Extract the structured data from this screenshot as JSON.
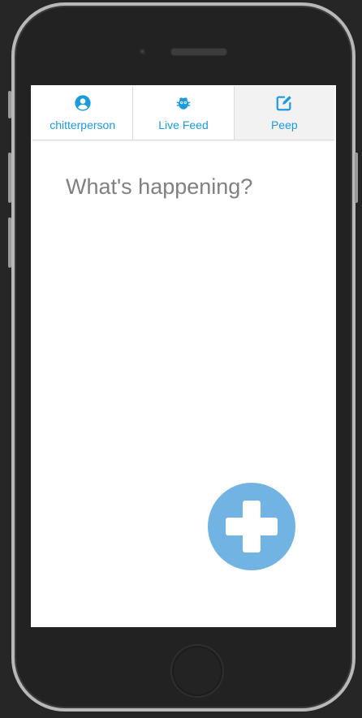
{
  "nav": {
    "items": [
      {
        "label": "chitterperson",
        "icon": "user-circle-icon"
      },
      {
        "label": "Live Feed",
        "icon": "bug-icon"
      },
      {
        "label": "Peep",
        "icon": "edit-icon"
      }
    ]
  },
  "compose": {
    "placeholder": "What's happening?"
  },
  "fab": {
    "icon": "plus-icon"
  },
  "colors": {
    "accent": "#1a9be0",
    "fab": "#71b3e3",
    "placeholder": "#808080"
  }
}
